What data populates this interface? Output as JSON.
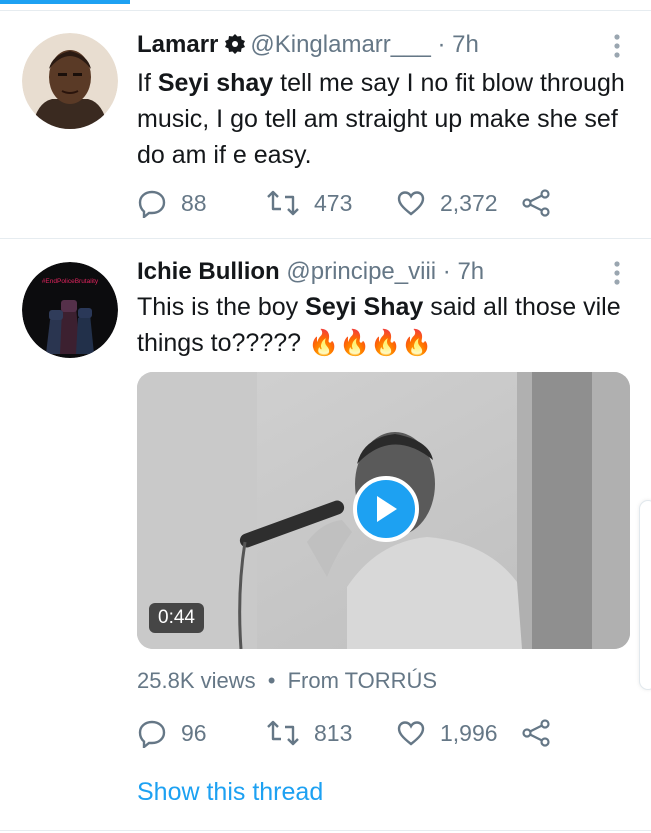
{
  "colors": {
    "accent": "#1da1f2",
    "text": "#14171a",
    "muted": "#657786",
    "fire": "#f4900c"
  },
  "tweets": [
    {
      "name": "Lamarr",
      "handle": "@Kinglamarr___",
      "time": "· 7h",
      "text_parts": [
        "If ",
        "Seyi shay",
        " tell me say I no fit blow through music, I go tell am straight up make she sef do am if e easy."
      ],
      "replies": "88",
      "retweets": "473",
      "likes": "2,372",
      "icons": [
        "verified-badge-icon",
        "more-vertical-icon",
        "reply-icon",
        "retweet-icon",
        "like-icon",
        "share-icon"
      ]
    },
    {
      "name": "Ichie Bullion",
      "handle": "@principe_viii",
      "time": "· 7h",
      "avatar_text": "#EndPoliceBrutality",
      "text_parts": [
        "This is the boy ",
        "Seyi Shay",
        " said all those vile things to????? "
      ],
      "emoji": "🔥🔥🔥🔥",
      "video_duration": "0:44",
      "views": "25.8K views",
      "source_separator": "•",
      "source": "From TORRÚS",
      "replies": "96",
      "retweets": "813",
      "likes": "1,996",
      "show_thread": "Show this thread",
      "icons": [
        "more-vertical-icon",
        "play-icon",
        "reply-icon",
        "retweet-icon",
        "like-icon",
        "share-icon"
      ]
    }
  ]
}
